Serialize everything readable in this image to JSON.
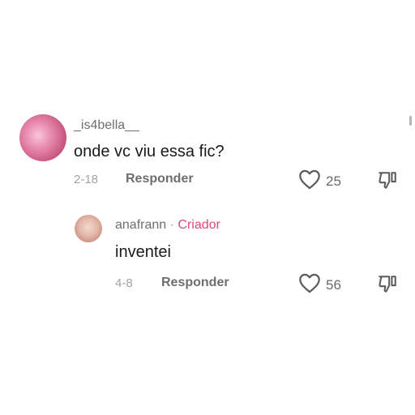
{
  "comment": {
    "username": "_is4bella__",
    "text": "onde vc viu essa fic?",
    "date": "2-18",
    "reply_label": "Responder",
    "likes": "25",
    "avatar_icon": "avatar-image",
    "like_icon": "heart-outline-icon",
    "dislike_icon": "thumbs-down-icon"
  },
  "reply": {
    "username": "anafrann",
    "separator": "·",
    "badge": "Criador",
    "text": "inventei",
    "date": "4-8",
    "reply_label": "Responder",
    "likes": "56",
    "avatar_icon": "avatar-image",
    "like_icon": "heart-outline-icon",
    "dislike_icon": "thumbs-down-icon"
  },
  "colors": {
    "creator_badge": "#e0477a",
    "text_primary": "#1a1a1a",
    "text_secondary": "#6f6f6f"
  }
}
